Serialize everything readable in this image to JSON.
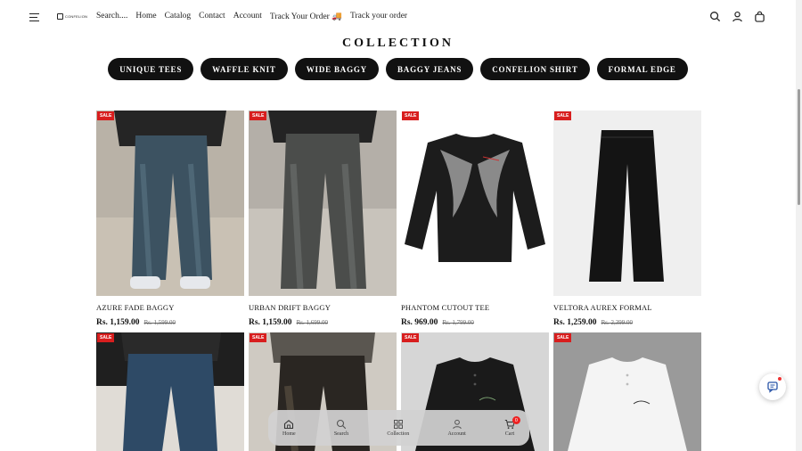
{
  "header": {
    "logo_text": "CONFELION",
    "nav": [
      "Search....",
      "Home",
      "Catalog",
      "Contact",
      "Account",
      "Track Your Order 🚚",
      "Track your order"
    ]
  },
  "collection": {
    "title": "COLLECTION",
    "pills": [
      "UNIQUE TEES",
      "WAFFLE KNIT",
      "WIDE BAGGY",
      "BAGGY JEANS",
      "CONFELION SHIRT",
      "FORMAL EDGE"
    ]
  },
  "products": [
    {
      "sale": "SALE",
      "name": "AZURE FADE BAGGY",
      "price": "Rs. 1,159.00",
      "old": "Rs. 1,599.00"
    },
    {
      "sale": "SALE",
      "name": "URBAN DRIFT BAGGY",
      "price": "Rs. 1,159.00",
      "old": "Rs. 1,699.00"
    },
    {
      "sale": "SALE",
      "name": "PHANTOM CUTOUT TEE",
      "price": "Rs. 969.00",
      "old": "Rs. 1,799.00"
    },
    {
      "sale": "SALE",
      "name": "VELTORA AUREX FORMAL",
      "price": "Rs. 1,259.00",
      "old": "Rs. 2,399.00"
    },
    {
      "sale": "SALE"
    },
    {
      "sale": "SALE"
    },
    {
      "sale": "SALE"
    },
    {
      "sale": "SALE"
    }
  ],
  "bottom_nav": [
    {
      "label": "Home",
      "icon": "home-icon"
    },
    {
      "label": "Search",
      "icon": "search-icon"
    },
    {
      "label": "Collection",
      "icon": "grid-icon"
    },
    {
      "label": "Account",
      "icon": "user-icon"
    },
    {
      "label": "Cart",
      "icon": "cart-icon",
      "badge": "0"
    }
  ],
  "colors": {
    "pill_bg": "#111111",
    "sale_bg": "#d81e1e",
    "badge": "#e22222"
  }
}
